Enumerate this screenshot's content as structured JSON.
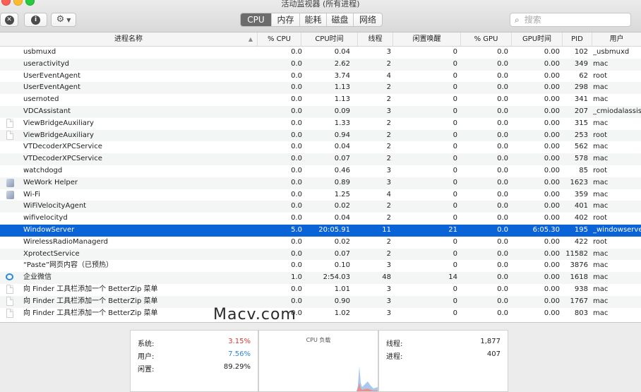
{
  "window": {
    "title": "活动监视器 (所有进程)"
  },
  "tabs": [
    {
      "label": "CPU",
      "active": true
    },
    {
      "label": "内存",
      "active": false
    },
    {
      "label": "能耗",
      "active": false
    },
    {
      "label": "磁盘",
      "active": false
    },
    {
      "label": "网络",
      "active": false
    }
  ],
  "search": {
    "placeholder": "搜索"
  },
  "columns": {
    "name": "进程名称",
    "cpu": "% CPU",
    "cpu_time": "CPU时间",
    "threads": "线程",
    "idle_wakeups": "闲置唤醒",
    "gpu": "% GPU",
    "gpu_time": "GPU时间",
    "pid": "PID",
    "user": "用户"
  },
  "processes": [
    {
      "name": "usbmuxd",
      "cpu": "0.0",
      "cpu_time": "0.04",
      "threads": "3",
      "idle": "0",
      "gpu": "0.0",
      "gpu_time": "0.00",
      "pid": "102",
      "user": "_usbmuxd",
      "icon": "none"
    },
    {
      "name": "useractivityd",
      "cpu": "0.0",
      "cpu_time": "2.62",
      "threads": "2",
      "idle": "0",
      "gpu": "0.0",
      "gpu_time": "0.00",
      "pid": "349",
      "user": "mac",
      "icon": "none"
    },
    {
      "name": "UserEventAgent",
      "cpu": "0.0",
      "cpu_time": "3.74",
      "threads": "4",
      "idle": "0",
      "gpu": "0.0",
      "gpu_time": "0.00",
      "pid": "62",
      "user": "root",
      "icon": "none"
    },
    {
      "name": "UserEventAgent",
      "cpu": "0.0",
      "cpu_time": "1.13",
      "threads": "2",
      "idle": "0",
      "gpu": "0.0",
      "gpu_time": "0.00",
      "pid": "298",
      "user": "mac",
      "icon": "none"
    },
    {
      "name": "usernoted",
      "cpu": "0.0",
      "cpu_time": "1.13",
      "threads": "2",
      "idle": "0",
      "gpu": "0.0",
      "gpu_time": "0.00",
      "pid": "341",
      "user": "mac",
      "icon": "none"
    },
    {
      "name": "VDCAssistant",
      "cpu": "0.0",
      "cpu_time": "0.09",
      "threads": "3",
      "idle": "0",
      "gpu": "0.0",
      "gpu_time": "0.00",
      "pid": "207",
      "user": "_cmiodalassistants",
      "icon": "none"
    },
    {
      "name": "ViewBridgeAuxiliary",
      "cpu": "0.0",
      "cpu_time": "1.33",
      "threads": "2",
      "idle": "0",
      "gpu": "0.0",
      "gpu_time": "0.00",
      "pid": "315",
      "user": "mac",
      "icon": "doc"
    },
    {
      "name": "ViewBridgeAuxiliary",
      "cpu": "0.0",
      "cpu_time": "0.94",
      "threads": "2",
      "idle": "0",
      "gpu": "0.0",
      "gpu_time": "0.00",
      "pid": "253",
      "user": "root",
      "icon": "doc"
    },
    {
      "name": "VTDecoderXPCService",
      "cpu": "0.0",
      "cpu_time": "0.04",
      "threads": "2",
      "idle": "0",
      "gpu": "0.0",
      "gpu_time": "0.00",
      "pid": "562",
      "user": "mac",
      "icon": "none"
    },
    {
      "name": "VTDecoderXPCService",
      "cpu": "0.0",
      "cpu_time": "0.07",
      "threads": "2",
      "idle": "0",
      "gpu": "0.0",
      "gpu_time": "0.00",
      "pid": "578",
      "user": "mac",
      "icon": "none"
    },
    {
      "name": "watchdogd",
      "cpu": "0.0",
      "cpu_time": "0.46",
      "threads": "3",
      "idle": "0",
      "gpu": "0.0",
      "gpu_time": "0.00",
      "pid": "85",
      "user": "root",
      "icon": "none"
    },
    {
      "name": "WeWork Helper",
      "cpu": "0.0",
      "cpu_time": "0.89",
      "threads": "3",
      "idle": "0",
      "gpu": "0.0",
      "gpu_time": "0.00",
      "pid": "1623",
      "user": "mac",
      "icon": "app"
    },
    {
      "name": "Wi-Fi",
      "cpu": "0.0",
      "cpu_time": "1.25",
      "threads": "4",
      "idle": "0",
      "gpu": "0.0",
      "gpu_time": "0.00",
      "pid": "359",
      "user": "mac",
      "icon": "app"
    },
    {
      "name": "WiFiVelocityAgent",
      "cpu": "0.0",
      "cpu_time": "0.02",
      "threads": "2",
      "idle": "0",
      "gpu": "0.0",
      "gpu_time": "0.00",
      "pid": "401",
      "user": "mac",
      "icon": "none"
    },
    {
      "name": "wifivelocityd",
      "cpu": "0.0",
      "cpu_time": "0.04",
      "threads": "2",
      "idle": "0",
      "gpu": "0.0",
      "gpu_time": "0.00",
      "pid": "402",
      "user": "root",
      "icon": "none"
    },
    {
      "name": "WindowServer",
      "cpu": "5.0",
      "cpu_time": "20:05.91",
      "threads": "11",
      "idle": "21",
      "gpu": "0.0",
      "gpu_time": "6:05.30",
      "pid": "195",
      "user": "_windowserver",
      "icon": "none",
      "selected": true
    },
    {
      "name": "WirelessRadioManagerd",
      "cpu": "0.0",
      "cpu_time": "0.02",
      "threads": "2",
      "idle": "0",
      "gpu": "0.0",
      "gpu_time": "0.00",
      "pid": "422",
      "user": "root",
      "icon": "none"
    },
    {
      "name": "XprotectService",
      "cpu": "0.0",
      "cpu_time": "0.07",
      "threads": "2",
      "idle": "0",
      "gpu": "0.0",
      "gpu_time": "0.00",
      "pid": "11582",
      "user": "mac",
      "icon": "none"
    },
    {
      "name": "“Paste”网页内容（已预热）",
      "cpu": "0.0",
      "cpu_time": "0.10",
      "threads": "3",
      "idle": "0",
      "gpu": "0.0",
      "gpu_time": "0.00",
      "pid": "3876",
      "user": "mac",
      "icon": "none"
    },
    {
      "name": "企业微信",
      "cpu": "1.0",
      "cpu_time": "2:54.03",
      "threads": "48",
      "idle": "14",
      "gpu": "0.0",
      "gpu_time": "0.00",
      "pid": "1618",
      "user": "mac",
      "icon": "chat"
    },
    {
      "name": "向 Finder 工具栏添加一个 BetterZip 菜单",
      "cpu": "0.0",
      "cpu_time": "1.01",
      "threads": "3",
      "idle": "0",
      "gpu": "0.0",
      "gpu_time": "0.00",
      "pid": "938",
      "user": "mac",
      "icon": "doc"
    },
    {
      "name": "向 Finder 工具栏添加一个 BetterZip 菜单",
      "cpu": "0.0",
      "cpu_time": "0.90",
      "threads": "3",
      "idle": "0",
      "gpu": "0.0",
      "gpu_time": "0.00",
      "pid": "1767",
      "user": "mac",
      "icon": "doc"
    },
    {
      "name": "向 Finder 工具栏添加一个 BetterZip 菜单",
      "cpu": "0.0",
      "cpu_time": "1.02",
      "threads": "3",
      "idle": "0",
      "gpu": "0.0",
      "gpu_time": "0.00",
      "pid": "803",
      "user": "mac",
      "icon": "doc"
    }
  ],
  "watermark": "Macv.com",
  "summary": {
    "system_label": "系统:",
    "system_value": "3.15%",
    "user_label": "用户:",
    "user_value": "7.56%",
    "idle_label": "闲置:",
    "idle_value": "89.29%",
    "chart_title": "CPU 负载",
    "threads_label": "线程:",
    "threads_value": "1,877",
    "processes_label": "进程:",
    "processes_value": "407"
  },
  "colors": {
    "selection": "#0b63d8",
    "system": "#d8382d",
    "user": "#2f84d6"
  }
}
